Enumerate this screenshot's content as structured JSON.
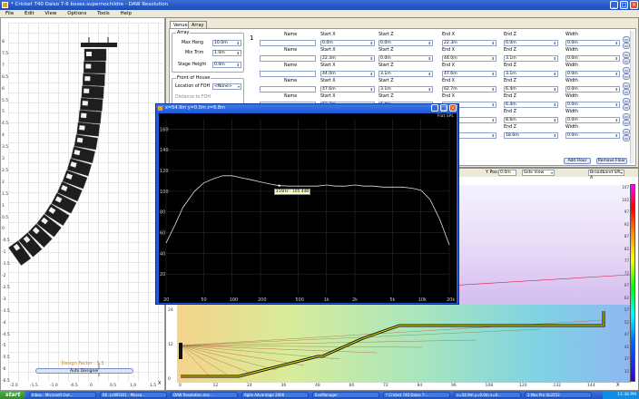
{
  "window": {
    "title": "* Cricket 740 Daiso 7-6 boxes.supernochildre - DAW Resolution"
  },
  "menu": [
    "File",
    "Edit",
    "View",
    "Options",
    "Tools",
    "Help"
  ],
  "left_panel": {
    "y_ticks": [
      "8",
      "7.5",
      "7",
      "6.5",
      "6",
      "5.5",
      "5",
      "4.5",
      "4",
      "3.5",
      "3",
      "2.5",
      "2",
      "1.5",
      "1",
      "0.5",
      "0",
      "-0.5",
      "-1",
      "-1.5",
      "-2",
      "-2.5",
      "-3",
      "-3.5",
      "-4",
      "-4.5",
      "-5",
      "-5.5",
      "-6",
      "-6.5"
    ],
    "x_ticks": [
      "-2.0",
      "-1.5",
      "-1.0",
      "-0.5",
      "0",
      "0.5",
      "1.0",
      "1.5"
    ],
    "design_factor": "Design Factor : 5.3",
    "auto_designer": "Auto Designer",
    "axis_x_label": "X"
  },
  "venue": {
    "tabs": [
      "Venue",
      "Array"
    ],
    "array_group": {
      "title": "Array",
      "max_hang_label": "Max Hang",
      "max_hang_value": "10.0m",
      "min_trim_label": "Min Trim",
      "min_trim_value": "1.0m",
      "stage_height_label": "Stage Height",
      "stage_height_value": "0.0m"
    },
    "foh_group": {
      "title": "Front of House",
      "location_label": "Location of FOH",
      "location_value": "<None>",
      "distance_label": "Distance to FOH"
    },
    "section_number": "1",
    "columns": [
      "Name",
      "Start X",
      "Start Z",
      "End X",
      "End Z",
      "Width"
    ],
    "rows": [
      {
        "name": "",
        "start_x": "0.0m",
        "start_z": "0.0m",
        "end_x": "22.3m",
        "end_z": "0.0m",
        "width": "0.0m"
      },
      {
        "name": "",
        "start_x": "22.3m",
        "start_z": "0.0m",
        "end_x": "44.0m",
        "end_z": "3.1m",
        "width": "0.0m"
      },
      {
        "name": "",
        "start_x": "44.0m",
        "start_z": "3.1m",
        "end_x": "47.6m",
        "end_z": "3.1m",
        "width": "0.0m"
      },
      {
        "name": "",
        "start_x": "47.6m",
        "start_z": "3.1m",
        "end_x": "62.7m",
        "end_z": "6.4m",
        "width": "0.0m"
      },
      {
        "name": "",
        "start_x": "62.7m",
        "start_z": "6.4m",
        "end_x": "",
        "end_z": "6.4m",
        "width": "0.0m"
      },
      {
        "name": "",
        "start_x": "",
        "start_z": "",
        "end_x": "",
        "end_z": "8.6m",
        "width": "0.0m"
      },
      {
        "name": "",
        "start_x": "",
        "start_z": "",
        "end_x": "",
        "end_z": "18.6m",
        "width": "0.0m"
      }
    ],
    "add_floor": "Add Floor",
    "remove_floor": "Remove Floor"
  },
  "spl_toolbar": {
    "y_pos_label": "Y Pos:",
    "y_pos_value": "0.0m",
    "view_value": "Side View",
    "band_value": "Broadband SPL A"
  },
  "spl_plot": {
    "y_ticks": [
      "24",
      "12",
      "0"
    ],
    "x_ticks": [
      "0",
      "12",
      "24",
      "36",
      "48",
      "60",
      "72",
      "84",
      "96",
      "108",
      "120",
      "132",
      "144"
    ],
    "colorbar_ticks": [
      "107",
      "102",
      "97",
      "92",
      "87",
      "82",
      "77",
      "72",
      "67",
      "62",
      "57",
      "52",
      "47",
      "42",
      "37",
      "32"
    ],
    "axis_x_label": "X"
  },
  "freq_window": {
    "title": "x=54.9m y=0.0m z=6.8m",
    "badge": "Flat SPL",
    "tooltip": "316Hz : 105.4dB",
    "chart_data": {
      "type": "line",
      "xlabel": "",
      "ylabel": "",
      "xscale": "log",
      "xlim": [
        20,
        20000
      ],
      "ylim": [
        0,
        170
      ],
      "x_ticks": [
        "20",
        "50",
        "100",
        "200",
        "500",
        "1k",
        "2k",
        "5k",
        "10k",
        "20k"
      ],
      "y_ticks": [
        "160",
        "140",
        "120",
        "100",
        "80",
        "60",
        "40",
        "20"
      ],
      "series": [
        {
          "x": [
            20,
            25,
            30,
            40,
            50,
            63,
            80,
            100,
            125,
            160,
            200,
            250,
            316,
            400,
            500,
            630,
            800,
            1000,
            1250,
            1600,
            2000,
            2500,
            3150,
            4000,
            5000,
            6300,
            8000,
            10000,
            12500,
            16000,
            20000
          ],
          "y": [
            50,
            68,
            84,
            100,
            108,
            112,
            115,
            115,
            113,
            111,
            109,
            107,
            105.4,
            105,
            105,
            105,
            105,
            106,
            105,
            105,
            106,
            105,
            105,
            104,
            104,
            104,
            103,
            101,
            92,
            72,
            48
          ]
        }
      ]
    }
  },
  "taskbar": {
    "start": "start",
    "items": [
      "Inbox - Microsoft Out...",
      "RE: LsWR301 - Messa...",
      "DAW Resolution.doc...",
      "Agile Advantage 2006",
      "EvoManager",
      "* Cricket 740 Daiso 7-...",
      "x=54.9m y=0.0m z=6...",
      "2 Nex Pro UL2252"
    ],
    "clock": "11:38 PM"
  }
}
